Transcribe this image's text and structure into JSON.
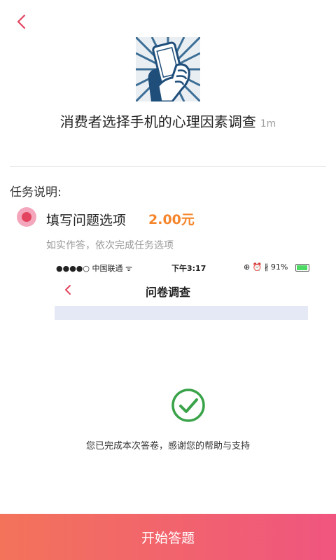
{
  "header": {
    "back_icon": "chevron-left-icon",
    "accent_color": "#e3445f"
  },
  "survey": {
    "title": "消费者选择手机的心理因素调查",
    "duration": "1m",
    "image_icon": "hand-holding-phone-illustration"
  },
  "task": {
    "section_label": "任务说明:",
    "item_title": "填写问题选项",
    "item_price": "2.00元",
    "item_description": "如实作答，依次完成任务选项",
    "price_color": "#f5852b"
  },
  "preview": {
    "carrier": "●●●●○ 中国联通 ᯤ",
    "time": "下午3:17",
    "status_icons": "⊕ ⏰ ∦ 91%",
    "battery_level": 0.91,
    "page_title": "问卷调查",
    "check_icon": "check-circle-icon",
    "completion_message": "您已完成本次答卷，感谢您的帮助与支持"
  },
  "footer": {
    "start_button_label": "开始答题",
    "gradient_start": "#f3735a",
    "gradient_end": "#f0557f"
  }
}
